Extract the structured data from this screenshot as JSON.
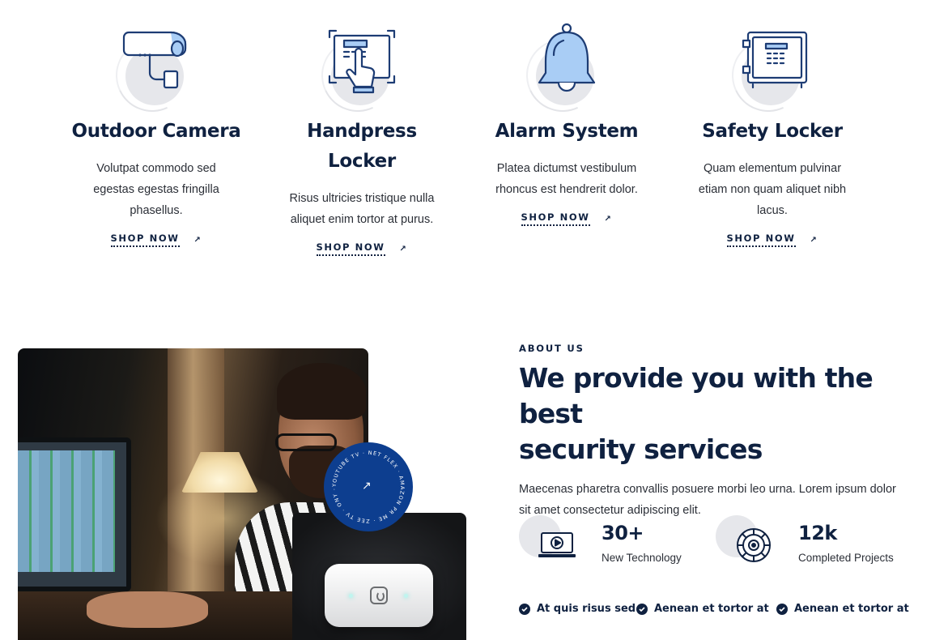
{
  "products": [
    {
      "title": "Outdoor Camera",
      "description": "Volutpat commodo sed egestas egestas fringilla phasellus.",
      "cta": "SHOP NOW",
      "icon": "security-camera-icon"
    },
    {
      "title": "Handpress Locker",
      "description": "Risus ultricies tristique nulla aliquet enim tortor at purus.",
      "cta": "SHOP NOW",
      "icon": "fingerprint-touch-icon"
    },
    {
      "title": "Alarm System",
      "description": "Platea dictumst vestibulum rhoncus est hendrerit dolor.",
      "cta": "SHOP NOW",
      "icon": "alarm-bell-icon"
    },
    {
      "title": "Safety Locker",
      "description": "Quam elementum pulvinar etiam non quam aliquet nibh lacus.",
      "cta": "SHOP NOW",
      "icon": "safe-locker-icon"
    }
  ],
  "about": {
    "eyebrow": "ABOUT US",
    "heading_line1": "We provide you with the best",
    "heading_line2": "security services",
    "description": "Maecenas pharetra convallis posuere morbi leo urna. Lorem ipsum dolor sit amet consectetur adipiscing elit.",
    "badge_text": "YOUTUBE TV · NET FLEX · AMAZON PR ME · ZEE TV · ONY ·"
  },
  "stats": [
    {
      "value": "30+",
      "caption": "New Technology",
      "icon": "video-monitor-icon"
    },
    {
      "value": "12k",
      "caption": "Completed Projects",
      "icon": "cctv-lens-icon"
    }
  ],
  "features": [
    "At quis risus sed",
    "Aenean et tortor at",
    "Aenean et tortor at"
  ],
  "colors": {
    "navy": "#0f2140",
    "accent_blue": "#0d3e8f",
    "icon_fill": "#a9cdf5",
    "blob_gray": "#e6e7eb"
  }
}
